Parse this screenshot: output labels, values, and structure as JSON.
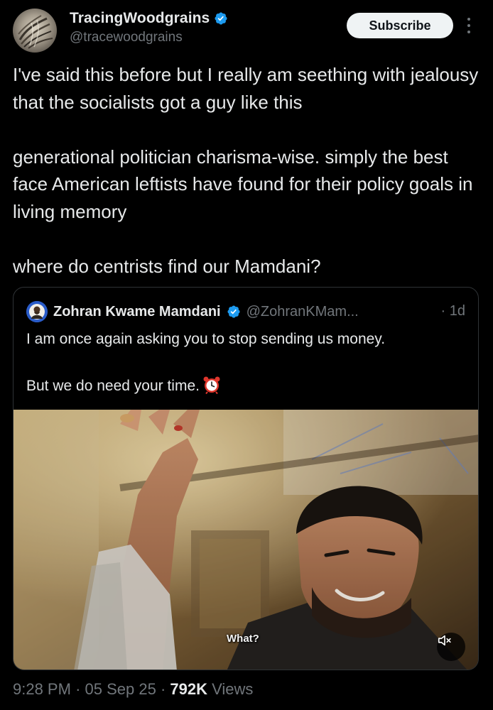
{
  "header": {
    "display_name": "TracingWoodgrains",
    "handle": "@tracewoodgrains",
    "subscribe_label": "Subscribe",
    "verified_icon": "verified-badge-icon",
    "more_icon": "more-options-icon"
  },
  "tweet": {
    "paragraphs": [
      "I've said this before but I really am seething with jealousy that the socialists got a guy like this",
      "generational politician charisma-wise. simply the best face American leftists have found for their policy goals in living memory",
      "where do centrists find our Mamdani?"
    ]
  },
  "quote": {
    "display_name": "Zohran Kwame Mamdani",
    "handle": "@ZohranKMam...",
    "separator": "·",
    "time": "1d",
    "paragraphs": [
      "I am once again asking you to stop sending us money.",
      "But we do need your time."
    ],
    "emoji_icon": "alarm-clock-icon",
    "video": {
      "caption": "What?",
      "mute_icon": "muted-speaker-icon"
    }
  },
  "footer": {
    "time": "9:28 PM",
    "separator": "·",
    "date": "05 Sep 25",
    "views_count": "792K",
    "views_label": "Views"
  },
  "colors": {
    "background": "#000000",
    "text_primary": "#e7e9ea",
    "text_secondary": "#71767b",
    "verified_blue": "#1d9bf0",
    "border": "#2f3336",
    "button_bg": "#eff3f4"
  }
}
